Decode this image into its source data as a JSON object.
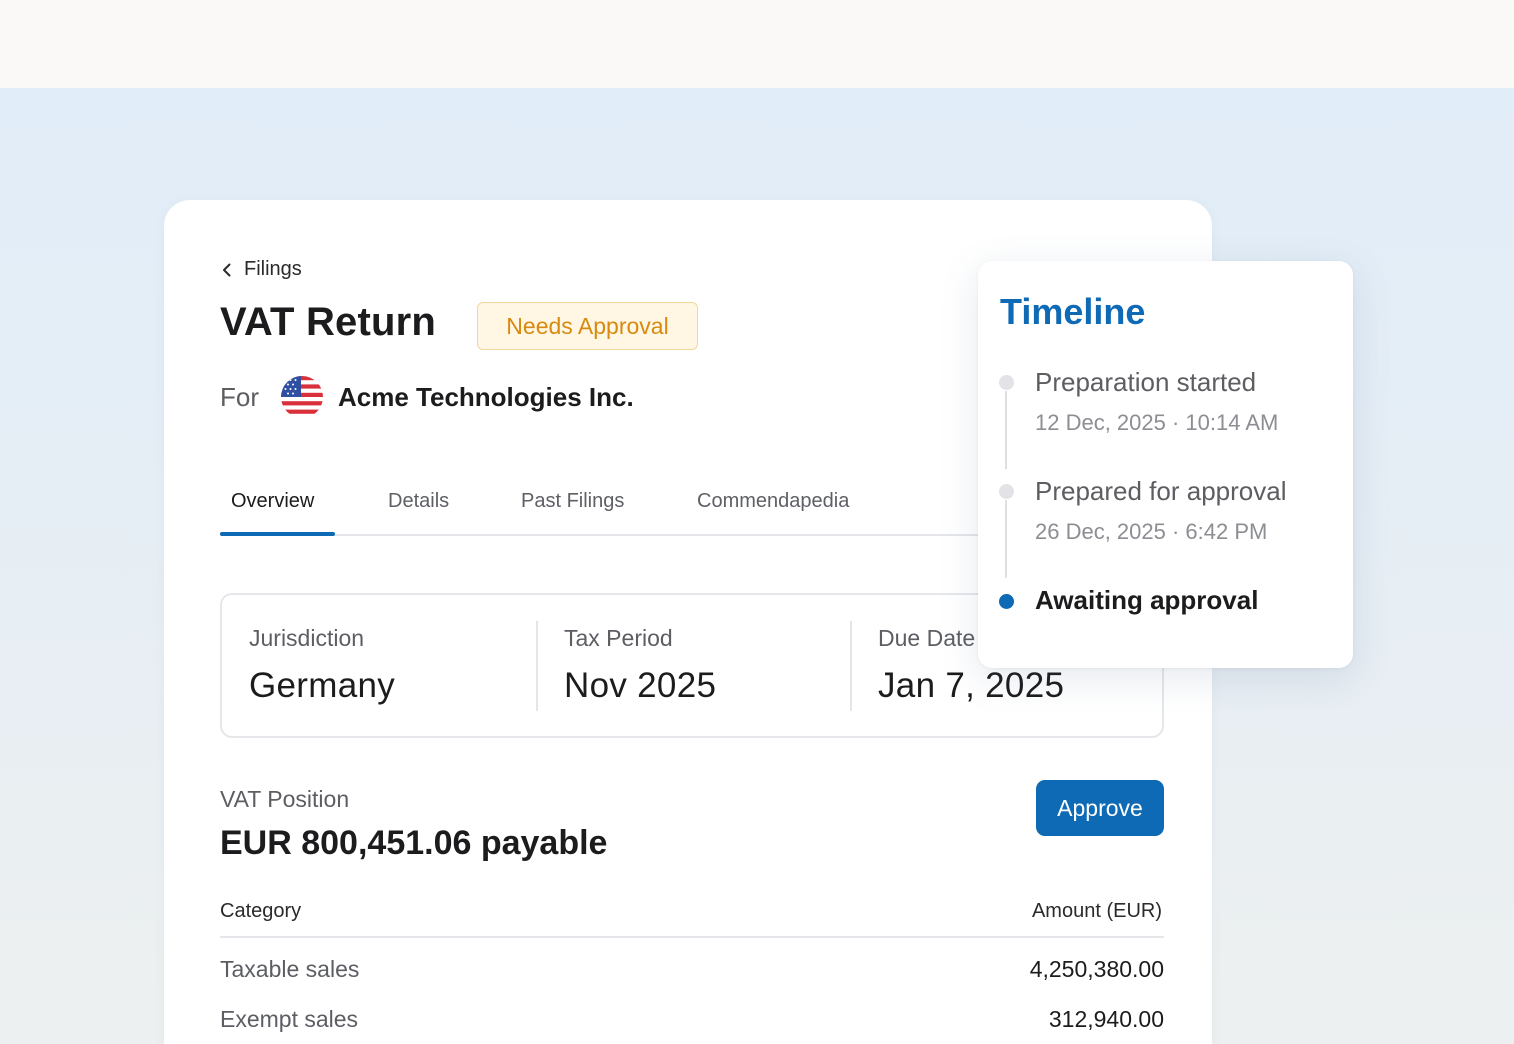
{
  "back": {
    "label": "Filings"
  },
  "filing": {
    "title": "VAT Return",
    "status": "Needs Approval",
    "for_label": "For",
    "company": "Acme Technologies Inc."
  },
  "tabs": [
    {
      "label": "Overview",
      "active": true
    },
    {
      "label": "Details",
      "active": false
    },
    {
      "label": "Past Filings",
      "active": false
    },
    {
      "label": "Commendapedia",
      "active": false
    }
  ],
  "facts": [
    {
      "label": "Jurisdiction",
      "value": "Germany"
    },
    {
      "label": "Tax Period",
      "value": "Nov 2025"
    },
    {
      "label": "Due Date",
      "value": "Jan 7, 2025"
    }
  ],
  "vat": {
    "label": "VAT Position",
    "amount": "EUR 800,451.06 payable",
    "approve_label": "Approve"
  },
  "table": {
    "headers": {
      "category": "Category",
      "amount": "Amount (EUR)"
    },
    "rows": [
      {
        "category": "Taxable sales",
        "amount": "4,250,380.00"
      },
      {
        "category": "Exempt sales",
        "amount": "312,940.00"
      }
    ]
  },
  "timeline": {
    "title": "Timeline",
    "events": [
      {
        "label": "Preparation started",
        "time": "12 Dec, 2025 · 10:14 AM",
        "state": "done"
      },
      {
        "label": "Prepared for approval",
        "time": "26 Dec, 2025 · 6:42 PM",
        "state": "done"
      },
      {
        "label": "Awaiting approval",
        "state": "current"
      }
    ]
  },
  "colors": {
    "accent": "#0f6ab5",
    "badge_text": "#d88a10",
    "badge_bg": "#fff7e3",
    "badge_border": "#f3d79a"
  },
  "icons": {
    "back": "chevron-left-icon",
    "flag": "us-flag-icon"
  }
}
